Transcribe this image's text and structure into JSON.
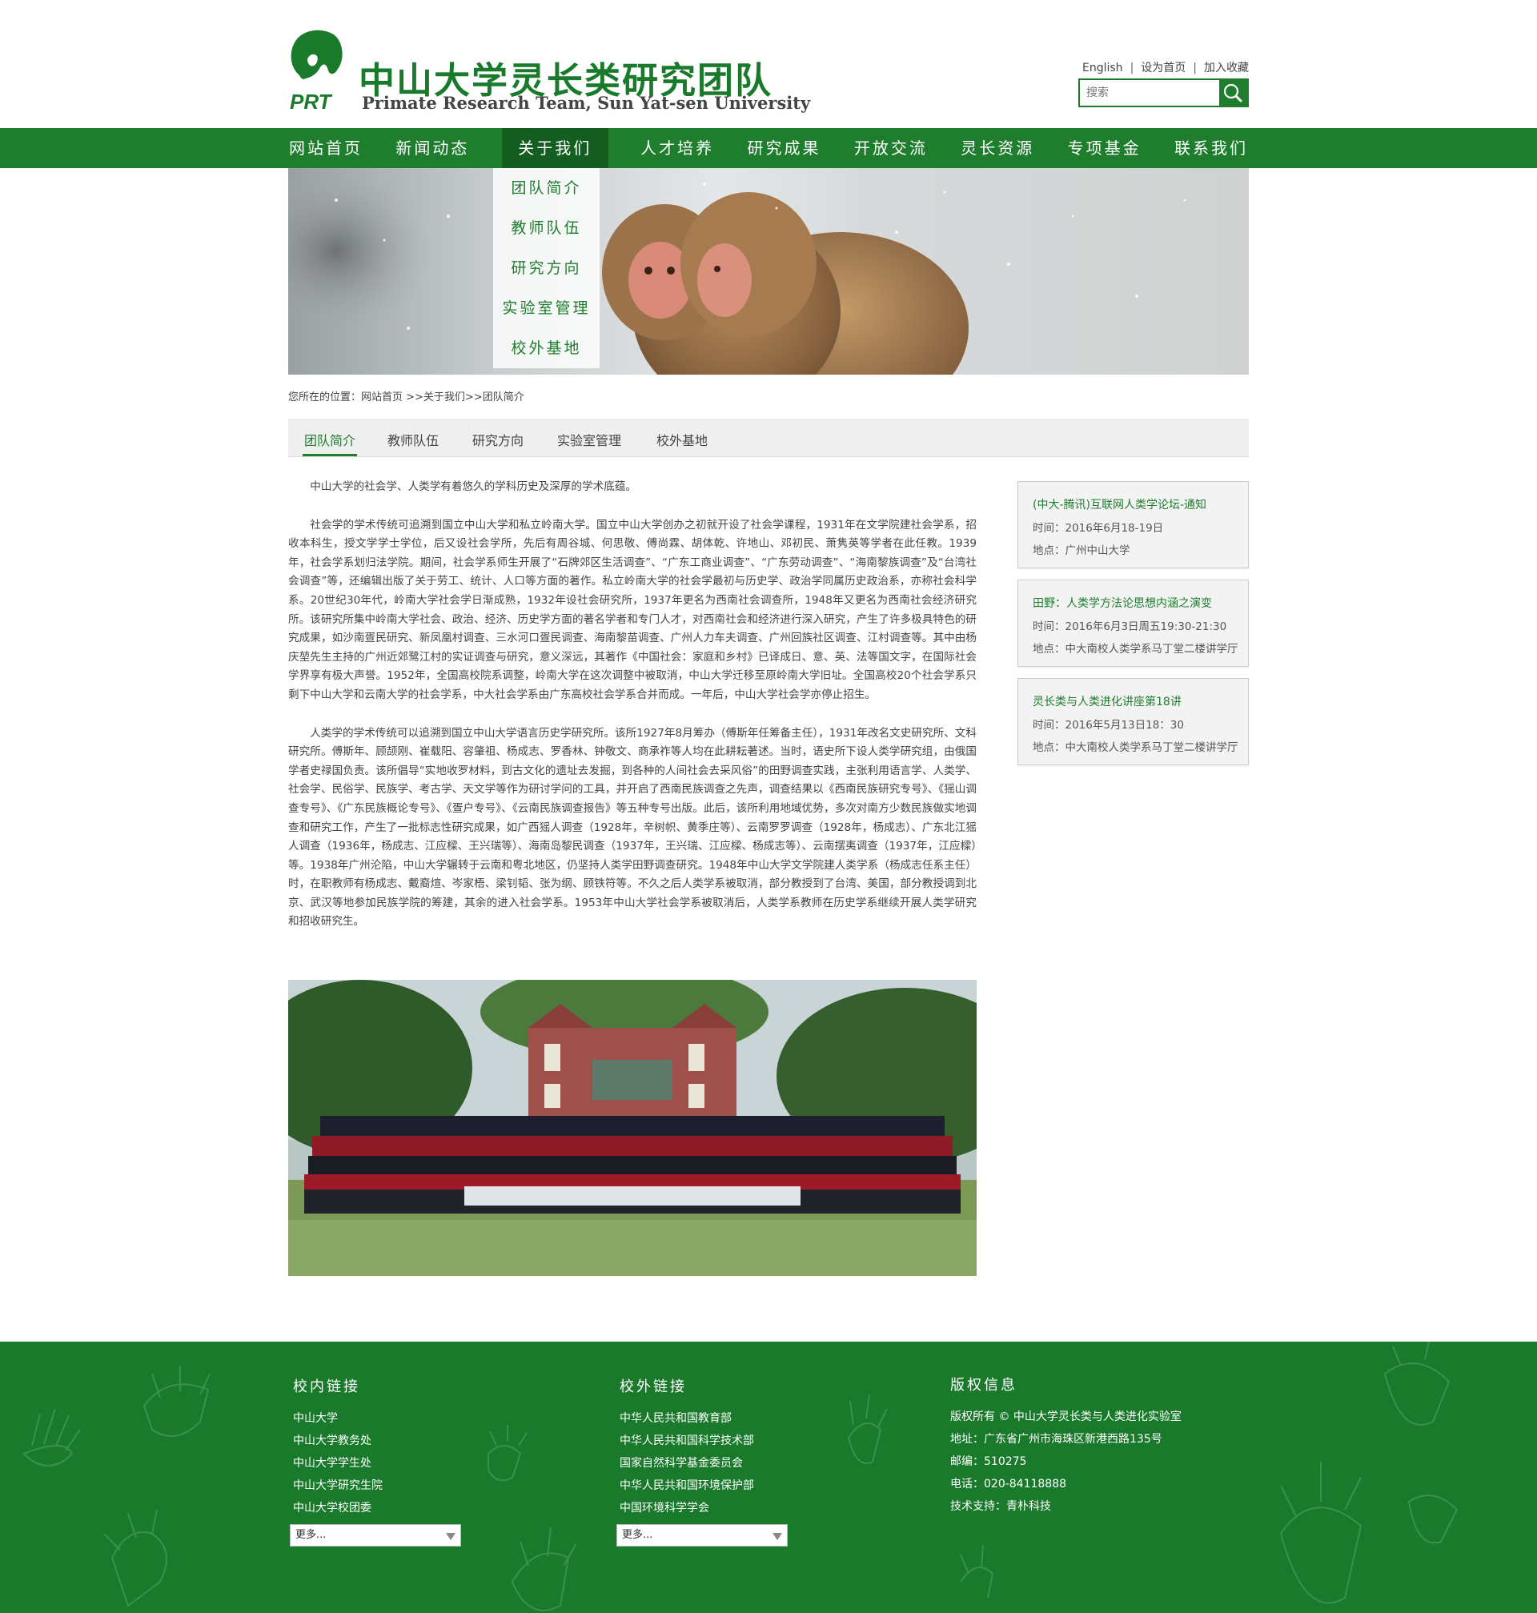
{
  "header": {
    "logo_mark": "PRT",
    "site_title": "中山大学灵长类研究团队",
    "site_subtitle": "Primate Research Team, Sun Yat-sen University",
    "top_links": [
      "English",
      "设为首页",
      "加入收藏"
    ],
    "search_placeholder": "搜索",
    "search_icon": "search-icon"
  },
  "nav": {
    "items": [
      "网站首页",
      "新闻动态",
      "关于我们",
      "人才培养",
      "研究成果",
      "开放交流",
      "灵长资源",
      "专项基金",
      "联系我们"
    ],
    "active_index": 2,
    "dropdown": [
      "团队简介",
      "教师队伍",
      "研究方向",
      "实验室管理",
      "校外基地"
    ]
  },
  "breadcrumb": "您所在的位置：网站首页 >>关于我们>>团队简介",
  "subtabs": {
    "items": [
      "团队简介",
      "教师队伍",
      "研究方向",
      "实验室管理",
      "校外基地"
    ],
    "active_index": 0
  },
  "article": {
    "paragraphs": [
      "中山大学的社会学、人类学有着悠久的学科历史及深厚的学术底蕴。",
      "社会学的学术传统可追溯到国立中山大学和私立岭南大学。国立中山大学创办之初就开设了社会学课程，1931年在文学院建社会学系，招收本科生，授文学学士学位，后又设社会学所，先后有周谷城、何思敬、傅尚霖、胡体乾、许地山、邓初民、萧隽英等学者在此任教。1939年，社会学系划归法学院。期间，社会学系师生开展了“石牌郊区生活调查”、“广东工商业调查”、“广东劳动调查”、“海南黎族调查”及“台湾社会调查”等，还编辑出版了关于劳工、统计、人口等方面的著作。私立岭南大学的社会学最初与历史学、政治学同属历史政治系，亦称社会科学系。20世纪30年代，岭南大学社会学日渐成熟，1932年设社会研究所，1937年更名为西南社会调查所，1948年又更名为西南社会经济研究所。该研究所集中岭南大学社会、政治、经济、历史学方面的著名学者和专门人才，对西南社会和经济进行深入研究，产生了许多极具特色的研究成果，如沙南疍民研究、新凤凰村调查、三水河口疍民调查、海南黎苗调查、广州人力车夫调查、广州回族社区调查、江村调查等。其中由杨庆堃先生主持的广州近郊鹭江村的实证调查与研究，意义深远，其著作《中国社会：家庭和乡村》已译成日、意、英、法等国文字，在国际社会学界享有极大声誉。1952年，全国高校院系调整，岭南大学在这次调整中被取消，中山大学迁移至原岭南大学旧址。全国高校20个社会学系只剩下中山大学和云南大学的社会学系，中大社会学系由广东高校社会学系合并而成。一年后，中山大学社会学亦停止招生。",
      "人类学的学术传统可以追溯到国立中山大学语言历史学研究所。该所1927年8月筹办（傅斯年任筹备主任），1931年改名文史研究所、文科研究所。傅斯年、顾颉刚、崔载阳、容肇祖、杨成志、罗香林、钟敬文、商承祚等人均在此耕耘著述。当时，语史所下设人类学研究组，由俄国学者史禄国负责。该所倡导“实地收罗材料，到古文化的遗址去发掘，到各种的人间社会去采风俗”的田野调查实践，主张利用语言学、人类学、社会学、民俗学、民族学、考古学、天文学等作为研讨学问的工具，并开启了西南民族调查之先声，调查结果以《西南民族研究专号》、《猺山调查专号》、《广东民族概论专号》、《疍户专号》、《云南民族调查报告》等五种专号出版。此后，该所利用地域优势，多次对南方少数民族做实地调查和研究工作，产生了一批标志性研究成果，如广西猺人调查（1928年，辛树帜、黄季庄等）、云南罗罗调查（1928年，杨成志）、广东北江猺人调查（1936年，杨成志、江应樑、王兴瑞等）、海南岛黎民调查（1937年，王兴瑞、江应樑、杨成志等）、云南摆夷调查（1937年，江应樑）等。1938年广州沦陷，中山大学辗转于云南和粤北地区，仍坚持人类学田野调查研究。1948年中山大学文学院建人类学系（杨成志任系主任）时，在职教师有杨成志、戴裔煊、岑家梧、梁钊韬、张为纲、顾铁符等。不久之后人类学系被取消，部分教授到了台湾、美国，部分教授调到北京、武汉等地参加民族学院的筹建，其余的进入社会学系。1953年中山大学社会学系被取消后，人类学系教师在历史学系继续开展人类学研究和招收研究生。"
    ]
  },
  "events": [
    {
      "title": "(中大-腾讯)互联网人类学论坛-通知",
      "time": "时间：2016年6月18-19日",
      "place": "地点：广州中山大学"
    },
    {
      "title": "田野：人类学方法论思想内涵之演变",
      "time": "时间：2016年6月3日周五19:30-21:30",
      "place": "地点：中大南校人类学系马丁堂二楼讲学厅"
    },
    {
      "title": "灵长类与人类进化讲座第18讲",
      "time": "时间：2016年5月13日18：30",
      "place": "地点：中大南校人类学系马丁堂二楼讲学厅"
    }
  ],
  "footer": {
    "internal": {
      "heading": "校内链接",
      "links": [
        "中山大学",
        "中山大学教务处",
        "中山大学学生处",
        "中山大学研究生院",
        "中山大学校团委"
      ],
      "select": "更多..."
    },
    "external": {
      "heading": "校外链接",
      "links": [
        "中华人民共和国教育部",
        "中华人民共和国科学技术部",
        "国家自然科学基金委员会",
        "中华人民共和国环境保护部",
        "中国环境科学学会"
      ],
      "select": "更多..."
    },
    "copyright": {
      "heading": "版权信息",
      "lines": [
        "版权所有 © 中山大学灵长类与人类进化实验室",
        "地址：广东省广州市海珠区新港西路135号",
        "邮编：510275",
        "电话：020-84118888",
        "技术支持：青朴科技"
      ]
    }
  },
  "colors": {
    "brand_green": "#1f7d2e",
    "nav_active": "#155e22",
    "footer_green": "#1a7a2b"
  }
}
